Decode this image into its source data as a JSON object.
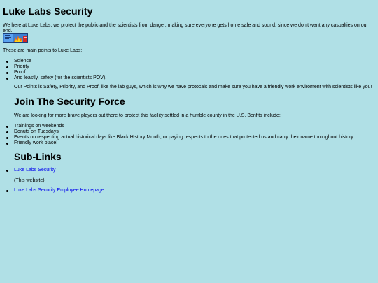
{
  "page": {
    "title": "Luke Labs Security",
    "intro": "We here at Luke Labs, we protect the public and the scientists from danger, making sure everyone gets home safe and sound, since we don't want any casualties on our end.",
    "points_label": "These are main points to Luke Labs:",
    "points": [
      "Science",
      "Priority",
      "Proof",
      "And leastly, safety (for the scientists POV)."
    ],
    "points_summary": "Our Points is Safety, Priority, and Proof, like the lab guys, which is why we have protocals and make sure you have a friendly work enviroment with scientists like you!",
    "join": {
      "heading": "Join The Security Force",
      "text": "We are looking for more brave players out there to protect this facility settled in a humble county in the U.S. Benfits include:",
      "benefits": [
        "Trainings on weekends",
        "Donuts on Tuesdays",
        "Events on respecting actual historical days like Black History Month, or paying respects to the ones that protected us and carry their name throughout history.",
        "Friendly work place!"
      ]
    },
    "sublinks": {
      "heading": "Sub-Links",
      "link1": "Luke Labs Security",
      "link1_note": "(This website)",
      "link2": "Luke Labs Security Employee Homepage"
    },
    "colors": {
      "background": "#b0e0e6",
      "link": "#0000ee"
    }
  }
}
